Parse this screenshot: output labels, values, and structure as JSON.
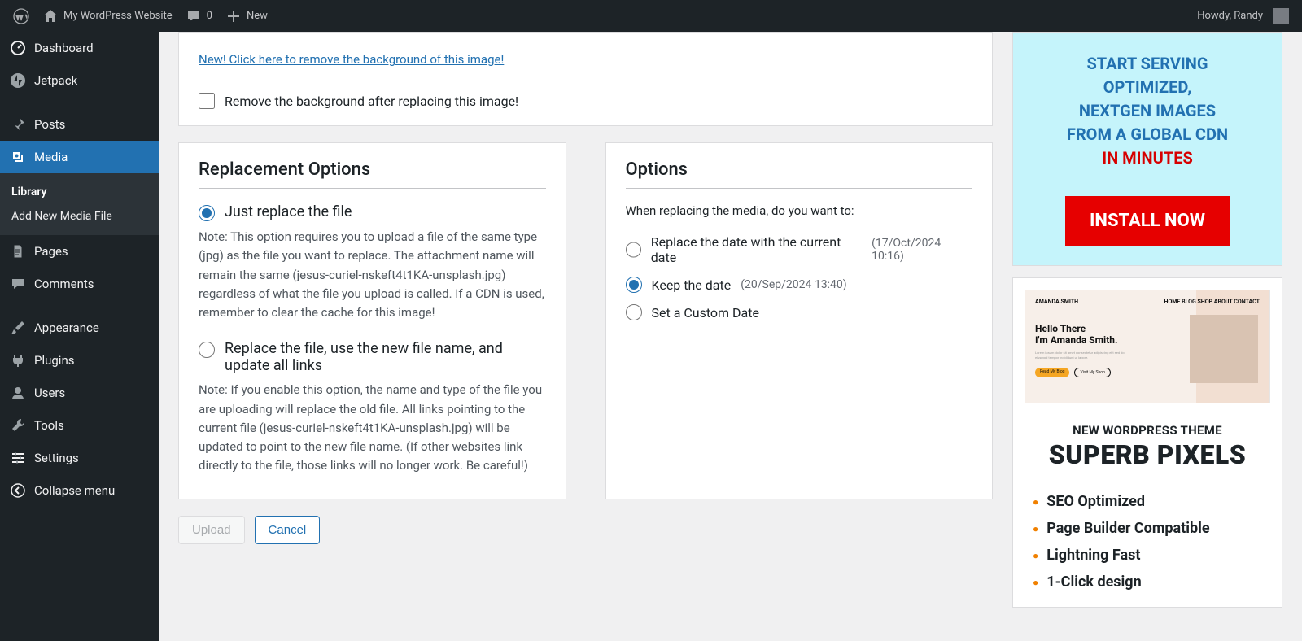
{
  "adminbar": {
    "site_name": "My WordPress Website",
    "comments_count": "0",
    "new_label": "New",
    "greeting": "Howdy, Randy"
  },
  "sidebar": {
    "items": [
      {
        "id": "dashboard",
        "label": "Dashboard"
      },
      {
        "id": "jetpack",
        "label": "Jetpack"
      },
      {
        "id": "posts",
        "label": "Posts"
      },
      {
        "id": "media",
        "label": "Media"
      },
      {
        "id": "pages",
        "label": "Pages"
      },
      {
        "id": "comments",
        "label": "Comments"
      },
      {
        "id": "appearance",
        "label": "Appearance"
      },
      {
        "id": "plugins",
        "label": "Plugins"
      },
      {
        "id": "users",
        "label": "Users"
      },
      {
        "id": "tools",
        "label": "Tools"
      },
      {
        "id": "settings",
        "label": "Settings"
      }
    ],
    "media_sub": {
      "library": "Library",
      "add_new": "Add New Media File"
    },
    "collapse": "Collapse menu"
  },
  "top": {
    "bg_link": "New! Click here to remove the background of this image!",
    "remove_bg_label": "Remove the background after replacing this image!"
  },
  "replace": {
    "heading": "Replacement Options",
    "opt1_label": "Just replace the file",
    "opt1_note": "Note: This option requires you to upload a file of the same type (jpg) as the file you want to replace. The attachment name will remain the same (jesus-curiel-nskeft4t1KA-unsplash.jpg) regardless of what the file you upload is called. If a CDN is used, remember to clear the cache for this image!",
    "opt2_label": "Replace the file, use the new file name, and update all links",
    "opt2_note": "Note: If you enable this option, the name and type of the file you are uploading will replace the old file. All links pointing to the current file (jesus-curiel-nskeft4t1KA-unsplash.jpg) will be updated to point to the new file name. (If other websites link directly to the file, those links will no longer work. Be careful!)"
  },
  "options": {
    "heading": "Options",
    "intro": "When replacing the media, do you want to:",
    "date1_label": "Replace the date with the current date",
    "date1_note": "(17/Oct/2024 10:16)",
    "date2_label": "Keep the date",
    "date2_note": "(20/Sep/2024 13:40)",
    "date3_label": "Set a Custom Date"
  },
  "buttons": {
    "upload": "Upload",
    "cancel": "Cancel"
  },
  "promo_cdn": {
    "l1": "START SERVING",
    "l2": "OPTIMIZED,",
    "l3": "NEXTGEN IMAGES",
    "l4": "FROM A GLOBAL CDN",
    "l5": "IN MINUTES",
    "cta": "INSTALL NOW"
  },
  "promo_theme": {
    "shot_name": "AMANDA SMITH",
    "shot_h1": "Hello There",
    "shot_h2": "I'm Amanda Smith.",
    "shot_btn1": "Read My Blog",
    "shot_btn2": "Visit My Shop",
    "shot_nav": [
      "HOME",
      "BLOG",
      "SHOP",
      "ABOUT",
      "CONTACT"
    ],
    "tag": "NEW WORDPRESS THEME",
    "name": "SUPERB PIXELS",
    "features": [
      "SEO Optimized",
      "Page Builder Compatible",
      "Lightning Fast",
      "1-Click design"
    ]
  }
}
